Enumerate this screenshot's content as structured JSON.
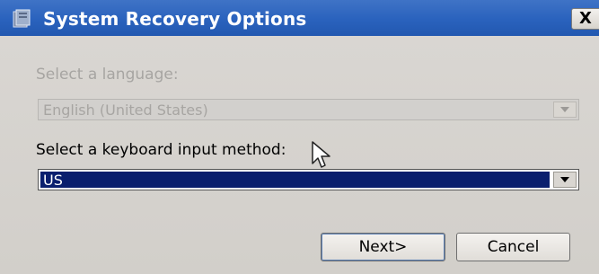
{
  "window": {
    "title": "System Recovery Options",
    "close_glyph": "X"
  },
  "language": {
    "label": "Select a language:",
    "value": "English (United States)",
    "enabled": false
  },
  "keyboard": {
    "label": "Select a keyboard input method:",
    "value": "US",
    "enabled": true
  },
  "buttons": {
    "next_label": "Next>",
    "cancel_label": "Cancel"
  },
  "colors": {
    "titlebar": "#2a62bd",
    "selection": "#0a1f6e",
    "disabled_text": "#a7a5a2",
    "dialog_bg": "#d4d0c8"
  }
}
